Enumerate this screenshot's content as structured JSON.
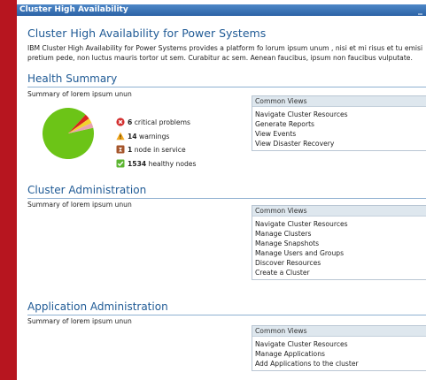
{
  "window": {
    "title": "Cluster High Availability",
    "minimize_label": "_"
  },
  "page": {
    "title": "Cluster High Availability for Power Systems",
    "intro_line1": "IBM Cluster High Availability for Power Systems provides a platform fo lorum ipsum unum , nisi et mi risus et tu emisi",
    "intro_line2": "pretium pede, non luctus mauris tortor ut sem. Curabitur ac sem. Aenean faucibus, ipsum non faucibus vulputate."
  },
  "health": {
    "title": "Health Summary",
    "summary": "Summary of lorem ipsum unun",
    "stats": [
      {
        "icon": "critical-error-icon",
        "count": "6",
        "label": "critical problems",
        "color": "#d32f2f"
      },
      {
        "icon": "warning-icon",
        "count": "14",
        "label": "warnings",
        "color": "#f2a81d"
      },
      {
        "icon": "in-service-icon",
        "count": "1",
        "label": "node in service",
        "color": "#a5552b"
      },
      {
        "icon": "healthy-check-icon",
        "count": "1534",
        "label": "healthy nodes",
        "color": "#5cb531"
      }
    ],
    "views": {
      "header": "Common Views",
      "items": [
        "Navigate Cluster Resources",
        "Generate Reports",
        "View Events",
        "View Disaster Recovery"
      ]
    }
  },
  "cluster_admin": {
    "title": "Cluster Administration",
    "summary": "Summary of lorem ipsum unun",
    "views": {
      "header": "Common Views",
      "items": [
        "Navigate Cluster Resources",
        "Manage Clusters",
        "Manage Snapshots",
        "Manage Users and Groups",
        "Discover Resources",
        "Create a Cluster"
      ]
    }
  },
  "app_admin": {
    "title": "Application Administration",
    "summary": "Summary of lorem ipsum unun",
    "views": {
      "header": "Common Views",
      "items": [
        "Navigate Cluster Resources",
        "Manage Applications",
        "Add Applications to the cluster"
      ]
    }
  },
  "chart_data": {
    "type": "pie",
    "categories": [
      "critical problems",
      "warnings",
      "node in service",
      "healthy nodes"
    ],
    "values": [
      6,
      14,
      1,
      1534
    ],
    "colors": [
      "#d9261c",
      "#f2d22e",
      "#e9a3b0",
      "#6cc417"
    ]
  }
}
